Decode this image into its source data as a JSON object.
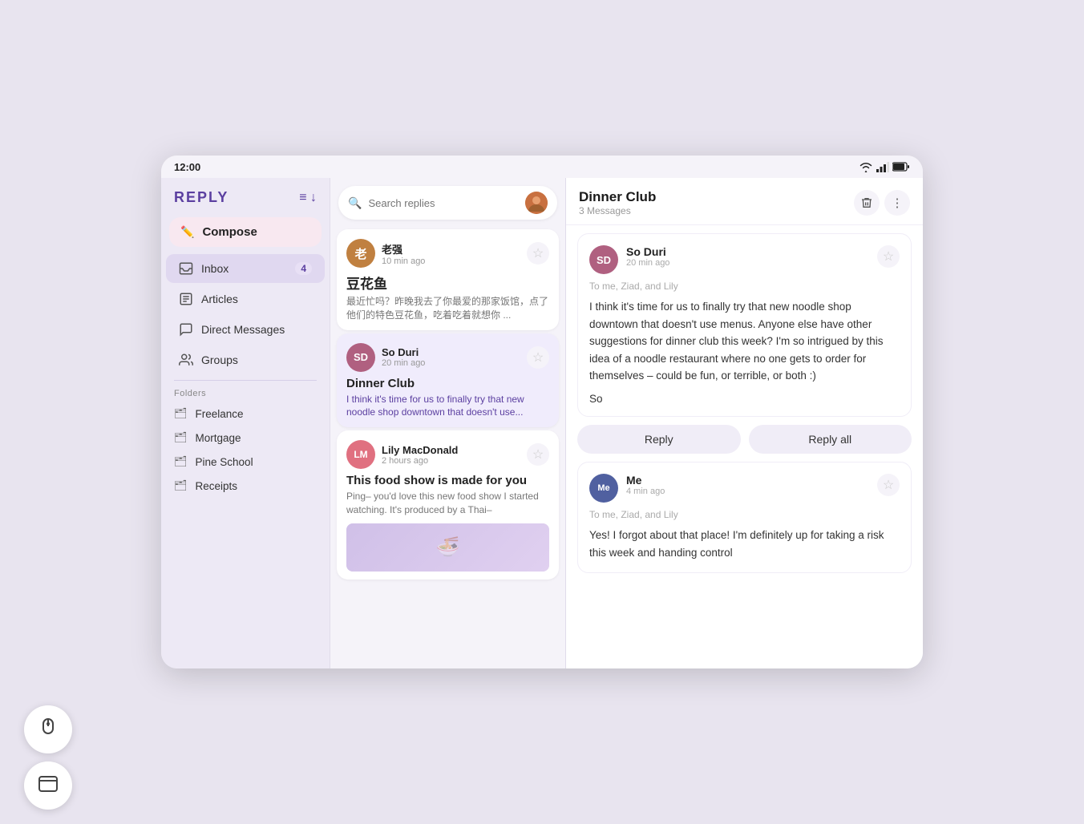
{
  "status_bar": {
    "time": "12:00"
  },
  "sidebar": {
    "brand": "REPLY",
    "compose_label": "Compose",
    "nav_items": [
      {
        "id": "inbox",
        "label": "Inbox",
        "badge": "4",
        "icon": "inbox"
      },
      {
        "id": "articles",
        "label": "Articles",
        "badge": "",
        "icon": "article"
      },
      {
        "id": "direct",
        "label": "Direct Messages",
        "badge": "",
        "icon": "chat"
      },
      {
        "id": "groups",
        "label": "Groups",
        "badge": "",
        "icon": "group"
      }
    ],
    "folders_label": "Folders",
    "folders": [
      {
        "label": "Freelance"
      },
      {
        "label": "Mortgage"
      },
      {
        "label": "Pine School"
      },
      {
        "label": "Receipts"
      }
    ]
  },
  "middle_panel": {
    "search_placeholder": "Search replies",
    "emails": [
      {
        "sender": "老强",
        "time": "10 min ago",
        "subject": "豆花鱼",
        "preview": "最近忙吗？昨晚我去了你最爱的那家饭馆，点了他们的特色豆花鱼，吃着吃着就想你 ...",
        "avatar_bg": "#c08040",
        "avatar_initials": "老"
      },
      {
        "sender": "So Duri",
        "time": "20 min ago",
        "subject": "Dinner Club",
        "preview": "I think it's time for us to finally try that new noodle shop downtown that doesn't use...",
        "avatar_bg": "#b06080",
        "avatar_initials": "SD",
        "active": true
      },
      {
        "sender": "Lily MacDonald",
        "time": "2 hours ago",
        "subject": "This food show is made for you",
        "preview": "Ping– you'd love this new food show I started watching. It's produced by a Thai–",
        "avatar_bg": "#e07080",
        "avatar_initials": "LM"
      }
    ]
  },
  "right_panel": {
    "thread_title": "Dinner Club",
    "thread_count": "3 Messages",
    "messages": [
      {
        "sender": "So Duri",
        "time": "20 min ago",
        "to": "To me, Ziad, and Lily",
        "body": "I think it's time for us to finally try that new noodle shop downtown that doesn't use menus. Anyone else have other suggestions for dinner club this week? I'm so intrigued by this idea of a noodle restaurant where no one gets to order for themselves – could be fun, or terrible, or both :)",
        "signature": "So",
        "avatar_bg": "#b06080",
        "avatar_initials": "SD"
      },
      {
        "sender": "Me",
        "time": "4 min ago",
        "to": "To me, Ziad, and Lily",
        "body": "Yes! I forgot about that place! I'm definitely up for taking a risk this week and handing control",
        "signature": "",
        "avatar_bg": "#5060a0",
        "avatar_initials": "Me"
      }
    ],
    "reply_btn": "Reply",
    "reply_all_btn": "Reply all"
  },
  "float_buttons": [
    {
      "id": "mouse",
      "icon": "🖱"
    },
    {
      "id": "window",
      "icon": "⬛"
    }
  ]
}
